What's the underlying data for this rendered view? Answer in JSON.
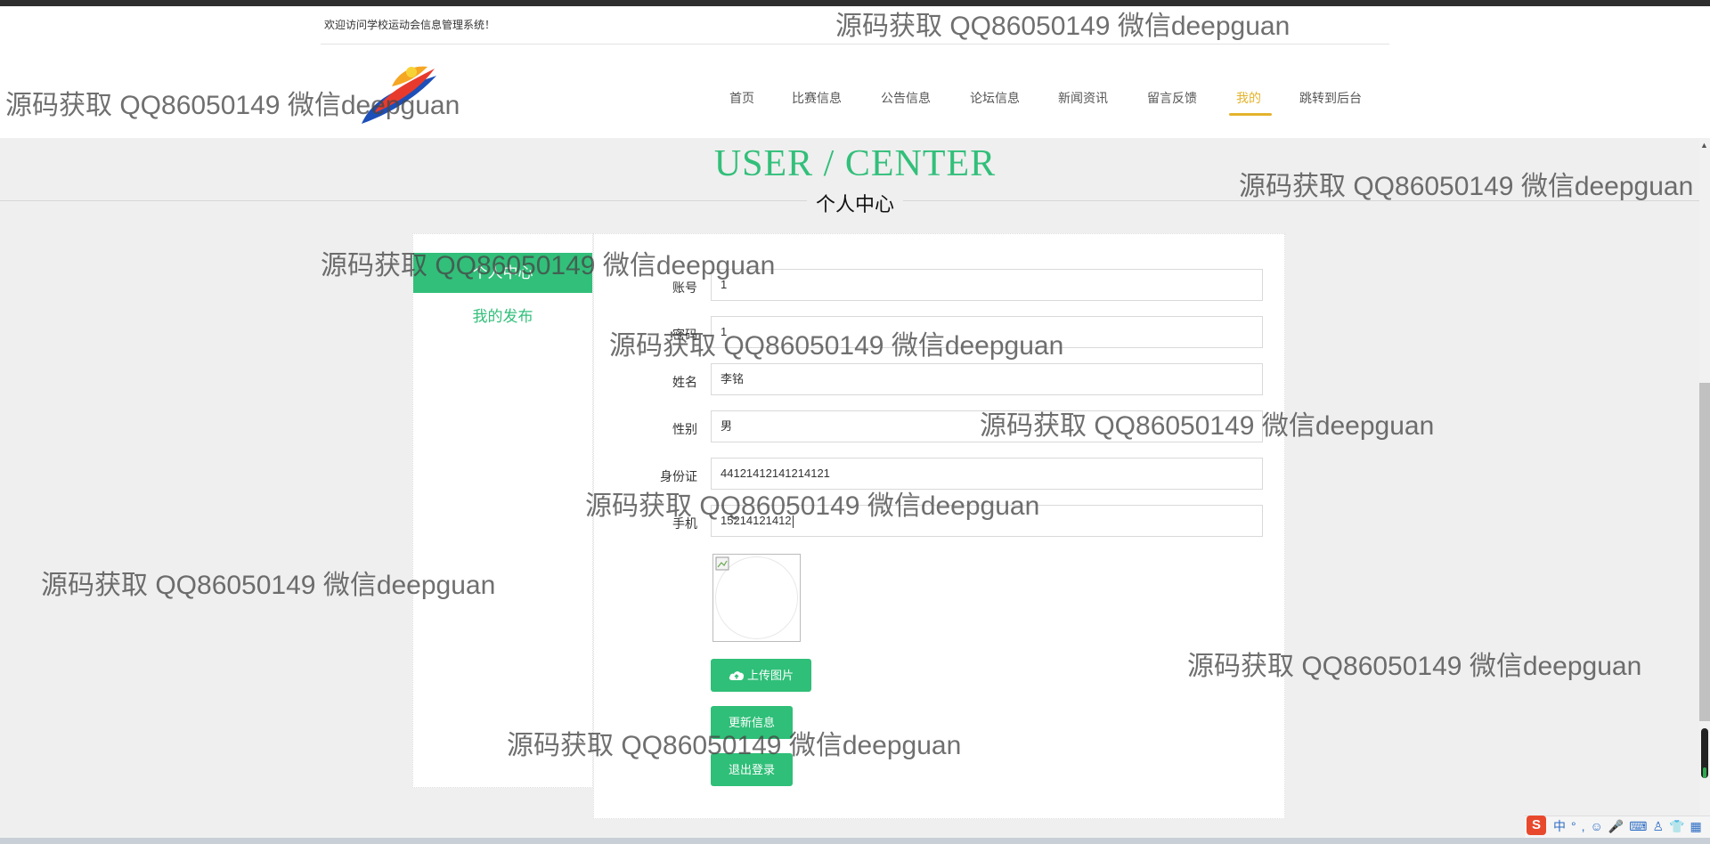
{
  "header": {
    "welcome": "欢迎访问学校运动会信息管理系统！",
    "nav": [
      {
        "label": "首页",
        "active": false
      },
      {
        "label": "比赛信息",
        "active": false
      },
      {
        "label": "公告信息",
        "active": false
      },
      {
        "label": "论坛信息",
        "active": false
      },
      {
        "label": "新闻资讯",
        "active": false
      },
      {
        "label": "留言反馈",
        "active": false
      },
      {
        "label": "我的",
        "active": true
      },
      {
        "label": "跳转到后台",
        "active": false
      }
    ]
  },
  "page_title": {
    "en": "USER / CENTER",
    "cn": "个人中心"
  },
  "sidebar": {
    "items": [
      {
        "label": "个人中心",
        "active": true
      },
      {
        "label": "我的发布",
        "active": false
      }
    ]
  },
  "form": {
    "fields": [
      {
        "label": "账号",
        "value": "1"
      },
      {
        "label": "密码",
        "value": "1"
      },
      {
        "label": "姓名",
        "value": "李铭"
      },
      {
        "label": "性别",
        "value": "男"
      },
      {
        "label": "身份证",
        "value": "44121412141214121"
      },
      {
        "label": "手机",
        "value": "15214121412"
      }
    ],
    "upload_label": "上传图片",
    "update_label": "更新信息",
    "logout_label": "退出登录"
  },
  "watermark": "源码获取 QQ86050149 微信deepguan",
  "colors": {
    "accent": "#32bf7a",
    "nav_active": "#e4b32c",
    "background": "#efefef"
  },
  "tray": {
    "ime_label": "中",
    "logo": "S"
  }
}
